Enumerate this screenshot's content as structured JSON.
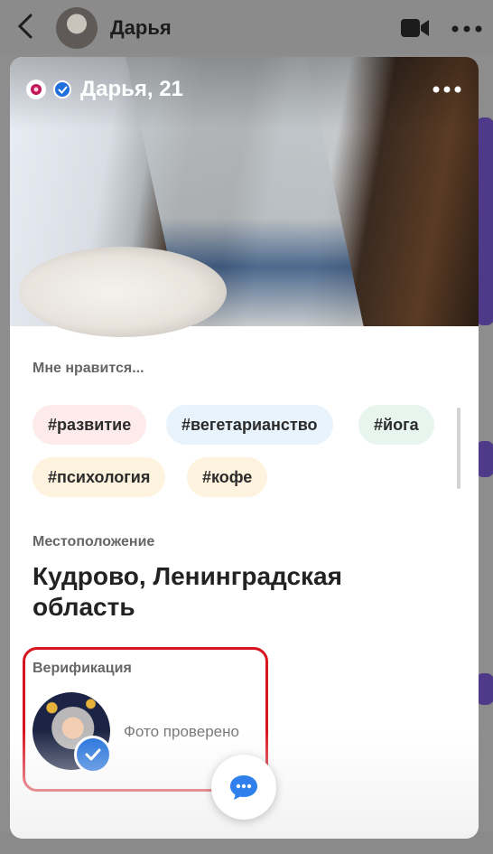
{
  "chat_header": {
    "contact_name": "Дарья"
  },
  "profile": {
    "name_age": "Дарья, 21",
    "likes_label": "Мне нравится...",
    "tags": [
      "#развитие",
      "#вегетарианство",
      "#йога",
      "#психология",
      "#кофе"
    ],
    "location_label": "Местоположение",
    "location_value": "Кудрово, Ленинградская область",
    "verification_label": "Верификация",
    "verification_status": "Фото проверено"
  },
  "colors": {
    "accent_blue": "#1f6fdc",
    "highlight_red": "#d8141f",
    "chat_bubble_purple": "#4f3a89"
  },
  "icons": {
    "back": "chevron-left-icon",
    "video": "video-camera-icon",
    "more": "more-horizontal-icon",
    "verified": "check-icon",
    "chat": "chat-bubble-icon"
  }
}
